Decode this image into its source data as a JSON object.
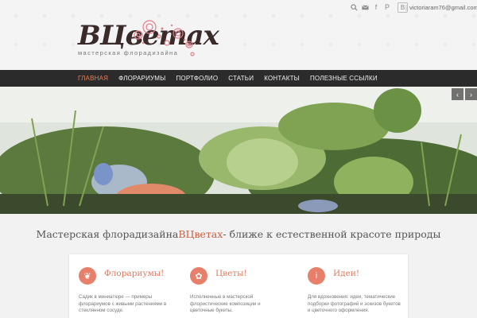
{
  "topbar": {
    "email": "victoriaram76@gmail.com",
    "separator": "|",
    "icons": [
      "search-icon",
      "mail-icon",
      "facebook-icon",
      "pinterest-icon",
      "blog-icon"
    ]
  },
  "logo": {
    "title": "ВЦветах",
    "subtitle": "мастерская флорадизайна"
  },
  "nav": {
    "items": [
      {
        "label": "ГЛАВНАЯ",
        "active": true
      },
      {
        "label": "ФЛОРАРИУМЫ"
      },
      {
        "label": "ПОРТФОЛИО"
      },
      {
        "label": "СТАТЬИ"
      },
      {
        "label": "КОНТАКТЫ"
      },
      {
        "label": "ПОЛЕЗНЫЕ ССЫЛКИ"
      }
    ]
  },
  "slider": {
    "prev": "‹",
    "next": "›"
  },
  "tagline": {
    "before": "Мастерская флорадизайна ",
    "brand": "ВЦветах",
    "after": " - ближе к естественной красоте природы"
  },
  "cards": [
    {
      "title": "Флорариумы!",
      "text": "Садик в миниатюре — примеры флорариумов с живыми растениями в стеклянном сосуде.",
      "icon": "leaf-icon"
    },
    {
      "title": "Цветы!",
      "text": "Исполненные в мастерской флористические композиции и цветочные букеты.",
      "icon": "tulip-icon"
    },
    {
      "title": "Идеи!",
      "text": "Для вдохновения: идеи, тематические подборки фотографий и эскизов букетов и цветочного оформления.",
      "icon": "info-icon"
    }
  ],
  "colors": {
    "accent": "#e97b4e",
    "nav_bg": "#2b2b2b",
    "brand": "#d05a3a",
    "card_title": "#e07a5f"
  }
}
